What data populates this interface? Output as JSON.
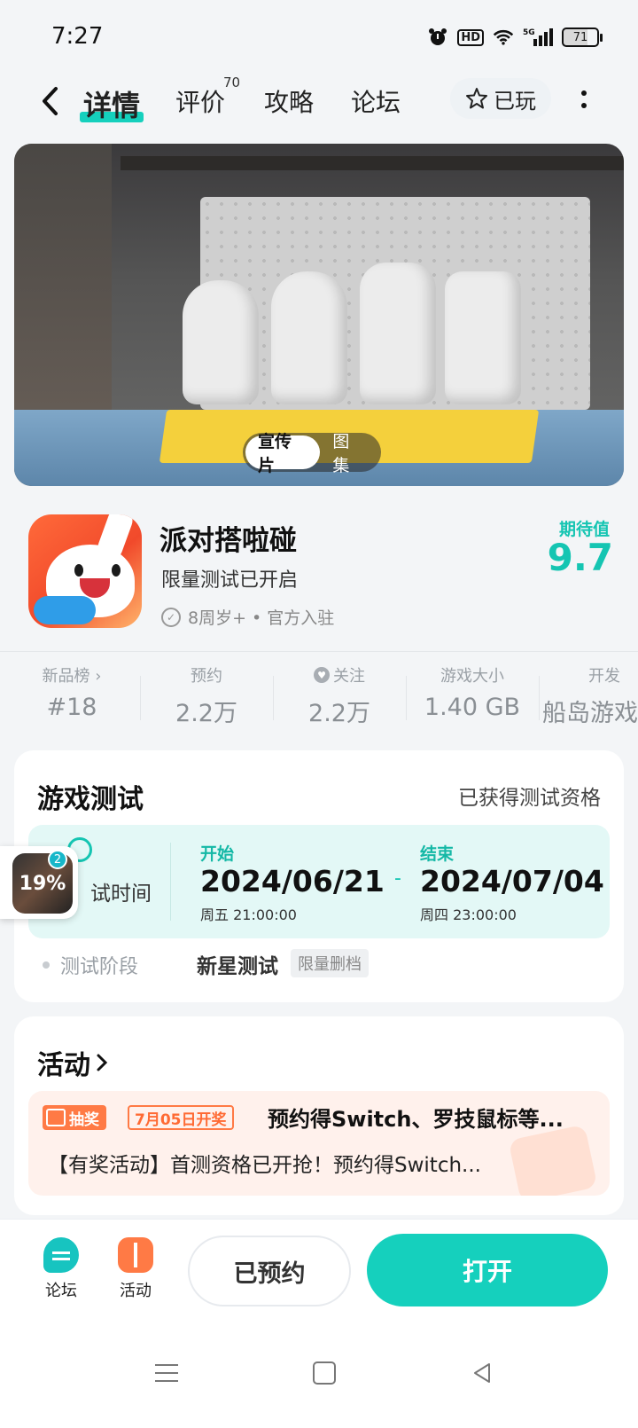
{
  "status_bar": {
    "time": "7:27",
    "hd_label": "HD",
    "network_label": "5G",
    "battery": "71"
  },
  "header": {
    "tabs": [
      {
        "label": "详情",
        "active": true
      },
      {
        "label": "评价",
        "badge": "70"
      },
      {
        "label": "攻略"
      },
      {
        "label": "论坛"
      }
    ],
    "played_label": "已玩"
  },
  "banner": {
    "toggle": [
      "宣传片",
      "图集"
    ],
    "active_toggle": "宣传片"
  },
  "game": {
    "title": "派对搭啦碰",
    "subtitle": "限量测试已开启",
    "meta": "8周岁+ • 官方入驻",
    "expect_label": "期待值",
    "expect_score": "9.7"
  },
  "stats": [
    {
      "label": "新品榜 ›",
      "value": "#18"
    },
    {
      "label": "预约",
      "value": "2.2万"
    },
    {
      "label": "关注",
      "value": "2.2万",
      "icon": "heart-icon"
    },
    {
      "label": "游戏大小",
      "value": "1.40 GB"
    },
    {
      "label": "开发",
      "value": "船岛游戏"
    }
  ],
  "test": {
    "title": "游戏测试",
    "qualification": "已获得测试资格",
    "time_label": "试时间",
    "start_label": "开始",
    "start_date": "2024/06/21",
    "start_time": "周五  21:00:00",
    "separator": "-",
    "end_label": "结束",
    "end_date": "2024/07/04",
    "end_time": "周四  23:00:00",
    "phase_label": "测试阶段",
    "phase_value": "新星测试",
    "phase_tag": "限量删档"
  },
  "floating": {
    "percent": "19%",
    "count": "2"
  },
  "activity": {
    "title": "活动",
    "tag": "抽奖",
    "date_tag": "7月05日开奖",
    "headline": "预约得Switch、罗技鼠标等...",
    "description": "【有奖活动】首测资格已开抢！预约得Switch..."
  },
  "bottom_bar": {
    "forum_label": "论坛",
    "activity_label": "活动",
    "reserved_label": "已预约",
    "open_label": "打开"
  },
  "colors": {
    "accent": "#15d0bd",
    "activity": "#ff7a45"
  }
}
